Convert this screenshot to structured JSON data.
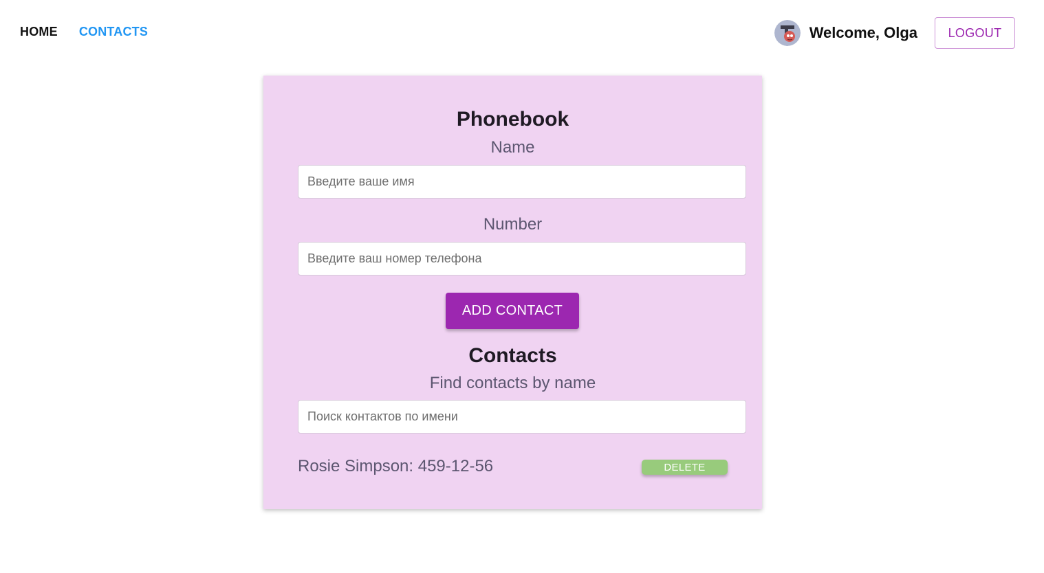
{
  "nav": {
    "home_label": "HOME",
    "contacts_label": "CONTACTS"
  },
  "user_menu": {
    "welcome_text": "Welcome, Olga",
    "logout_label": "LOGOUT",
    "avatar_icon": "user-avatar-icon"
  },
  "phonebook": {
    "title": "Phonebook",
    "name_label": "Name",
    "name_placeholder": "Введите ваше имя",
    "name_value": "",
    "number_label": "Number",
    "number_placeholder": "Введите ваш номер телефона",
    "number_value": "",
    "add_label": "ADD CONTACT"
  },
  "contacts": {
    "title": "Contacts",
    "filter_label": "Find contacts by name",
    "filter_placeholder": "Поиск контактов по имени",
    "filter_value": "",
    "items": [
      {
        "text": "Rosie Simpson: 459-12-56",
        "delete_label": "DELETE"
      }
    ]
  },
  "colors": {
    "accent": "#9c27b0",
    "link_active": "#2196f3",
    "card_background": "#f0d3f2",
    "delete_button": "#98cb7c"
  }
}
